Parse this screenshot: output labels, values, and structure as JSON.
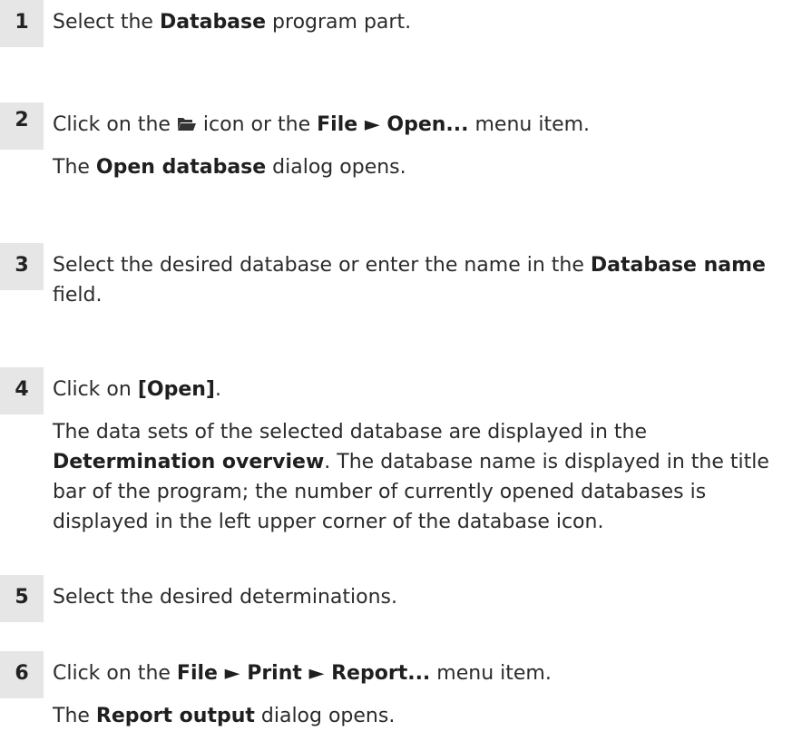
{
  "steps": [
    {
      "number": "1",
      "segments": [
        {
          "t": "Select the "
        },
        {
          "t": "Database",
          "b": true
        },
        {
          "t": " program part."
        }
      ]
    },
    {
      "number": "2",
      "segments": [
        {
          "t": "Click on the "
        },
        {
          "icon": "folder-open-icon"
        },
        {
          "t": " icon or the "
        },
        {
          "t": "File ► Open...",
          "b": true
        },
        {
          "t": " menu item."
        }
      ],
      "result": [
        {
          "t": "The "
        },
        {
          "t": "Open database",
          "b": true
        },
        {
          "t": " dialog opens."
        }
      ]
    },
    {
      "number": "3",
      "segments": [
        {
          "t": "Select the desired database or enter the name in the "
        },
        {
          "t": "Database name",
          "b": true
        },
        {
          "t": " field."
        }
      ]
    },
    {
      "number": "4",
      "segments": [
        {
          "t": "Click on "
        },
        {
          "t": "[Open]",
          "b": true
        },
        {
          "t": "."
        }
      ],
      "result": [
        {
          "t": "The data sets of the selected database are displayed in the "
        },
        {
          "t": "Determination overview",
          "b": true
        },
        {
          "t": ". The database name is displayed in the title bar of the program; the number of currently opened databases is displayed in the left upper corner of the database icon."
        }
      ]
    },
    {
      "number": "5",
      "segments": [
        {
          "t": "Select the desired determinations."
        }
      ]
    },
    {
      "number": "6",
      "segments": [
        {
          "t": "Click on the "
        },
        {
          "t": "File ► Print ► Report...",
          "b": true
        },
        {
          "t": " menu item."
        }
      ],
      "result": [
        {
          "t": "The "
        },
        {
          "t": "Report output",
          "b": true
        },
        {
          "t": " dialog opens."
        }
      ]
    }
  ]
}
